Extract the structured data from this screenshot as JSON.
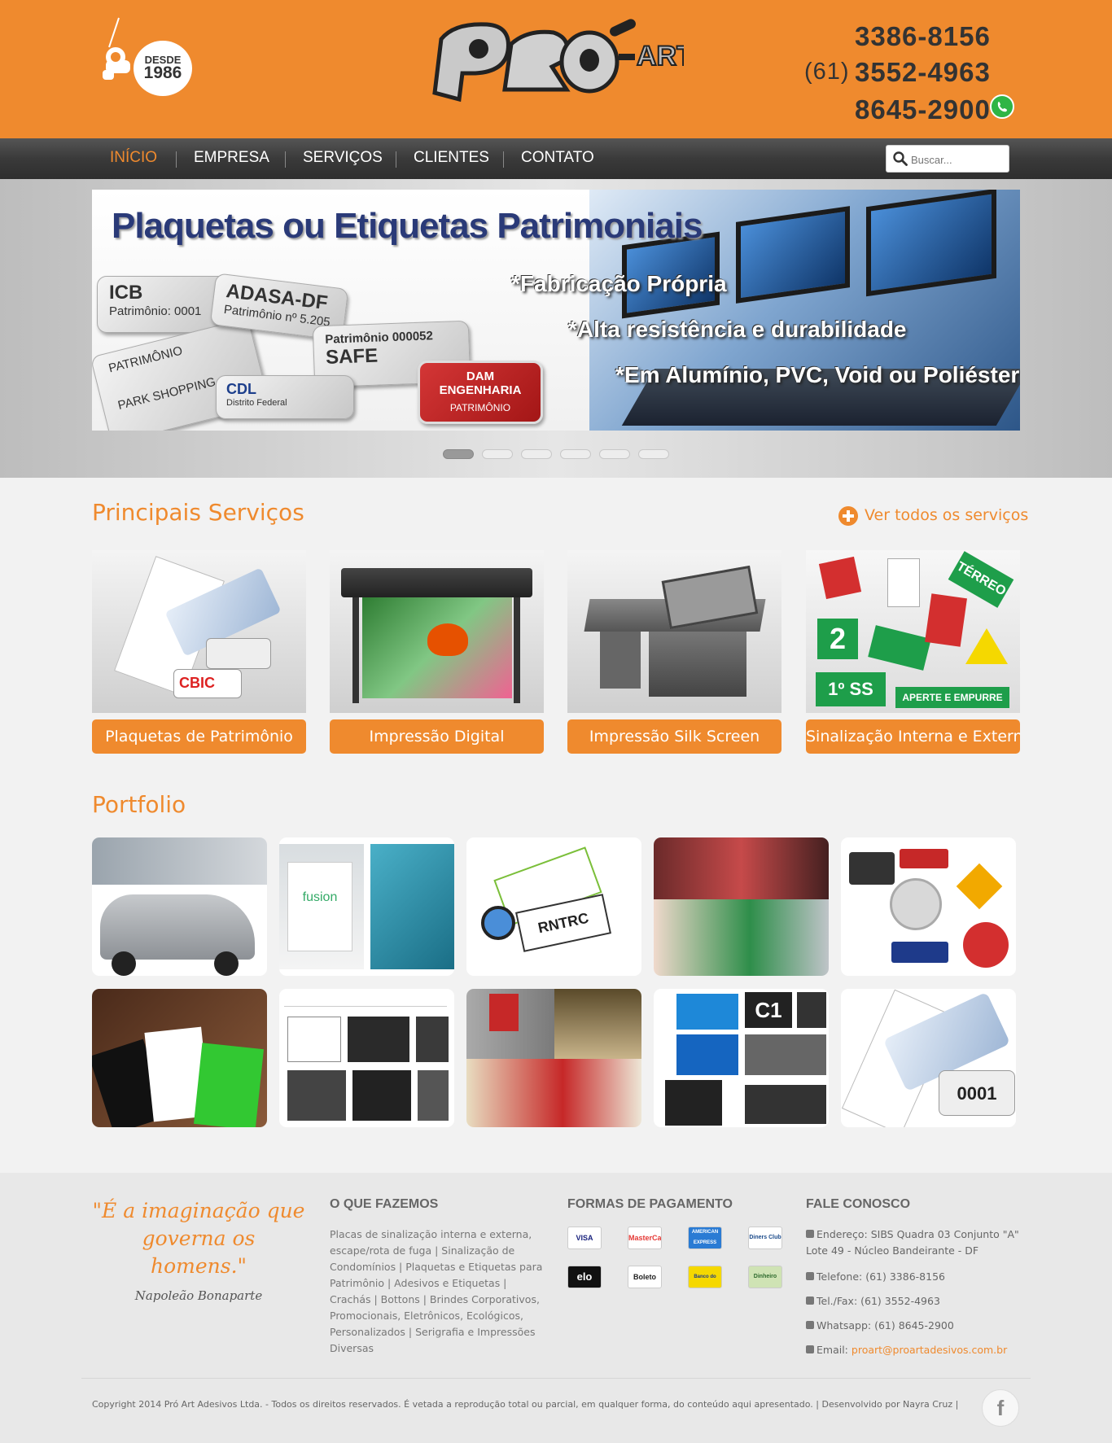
{
  "header": {
    "badge_line1": "DESDE",
    "badge_line2": "1986",
    "logo_text": "PRO-ART",
    "phone1": "3386-8156",
    "area_code": "(61)",
    "phone2": "3552-4963",
    "phone3": "8645-2900",
    "whatsapp_icon": "whatsapp-icon"
  },
  "nav": {
    "items": [
      {
        "label": "INÍCIO",
        "active": true
      },
      {
        "label": "EMPRESA",
        "active": false
      },
      {
        "label": "SERVIÇOS",
        "active": false
      },
      {
        "label": "CLIENTES",
        "active": false
      },
      {
        "label": "CONTATO",
        "active": false
      }
    ],
    "search_placeholder": "Buscar...",
    "search_icon": "search-icon"
  },
  "banner": {
    "title": "Plaquetas ou Etiquetas Patrimoniais",
    "lines": [
      "*Fabricação Própria",
      "*Alta resistência e durabilidade",
      "*Em Alumínio, PVC, Void ou Poliéster"
    ],
    "plates": {
      "icb_title": "ICB",
      "icb_sub": "Patrimônio: 0001",
      "adasa_title": "ADASA-DF",
      "adasa_sub": "Patrimônio nº 5.205",
      "safe_title": "SAFE",
      "safe_sub": "Patrimônio 000052",
      "park_title": "PARK SHOPPING",
      "park_sub": "PATRIMÔNIO",
      "cdl_title": "CDL",
      "cdl_sub": "Distrito Federal",
      "dam_title": "DAM ENGENHARIA",
      "dam_sub": "PATRIMÔNIO"
    },
    "slide_count": 6,
    "active_slide": 1
  },
  "services": {
    "title": "Principais Serviços",
    "see_all": "Ver todos os serviços",
    "items": [
      {
        "label": "Plaquetas de Patrimônio"
      },
      {
        "label": "Impressão Digital"
      },
      {
        "label": "Impressão Silk Screen"
      },
      {
        "label": "Sinalização Interna e Externa"
      }
    ]
  },
  "portfolio": {
    "title": "Portfolio"
  },
  "footer": {
    "quote": "\"É a imaginação que governa os homens.\"",
    "quote_author": "Napoleão Bonaparte",
    "what_title": "O QUE FAZEMOS",
    "what_text": "Placas de sinalização interna e externa, escape/rota de fuga | Sinalização de Condomínios | Plaquetas e Etiquetas para Patrimônio | Adesivos e Etiquetas | Crachás | Bottons | Brindes Corporativos, Promocionais, Eletrônicos, Ecológicos, Personalizados | Serigrafia e Impressões Diversas",
    "payment_title": "FORMAS DE PAGAMENTO",
    "payments": [
      "VISA",
      "MasterCard",
      "AMERICAN EXPRESS",
      "Diners Club",
      "elo",
      "Boleto",
      "Banco do Brasil",
      "Dinheiro"
    ],
    "contact_title": "FALE CONOSCO",
    "address": "Endereço: SIBS Quadra 03 Conjunto \"A\" Lote 49 - Núcleo Bandeirante - DF",
    "phone": "Telefone: (61) 3386-8156",
    "telfax": "Tel./Fax: (61) 3552-4963",
    "whatsapp": "Whatsapp: (61) 8645-2900",
    "email_label": "Email:",
    "email": "proart@proartadesivos.com.br",
    "copyright": "Copyright 2014 Pró Art Adesivos Ltda. - Todos os direitos reservados. É vetada a reprodução total ou parcial, em qualquer forma, do conteúdo aqui apresentado. | Desenvolvido por Nayra Cruz |",
    "facebook_label": "f"
  },
  "colors": {
    "brand_orange": "#ef8a2e",
    "nav_dark": "#333333"
  }
}
